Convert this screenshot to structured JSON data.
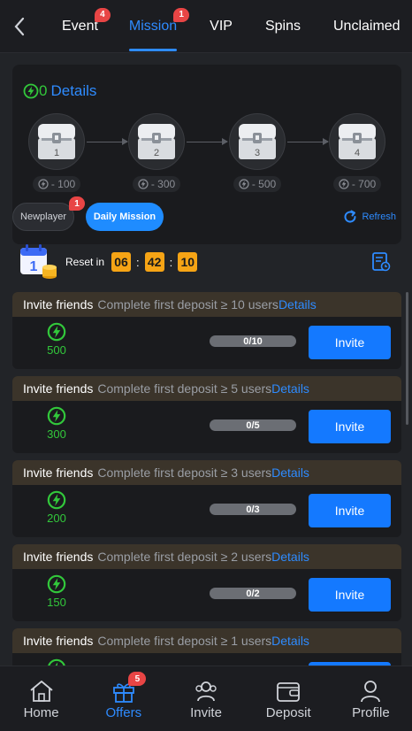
{
  "top_nav": {
    "tabs": [
      {
        "label": "Event",
        "badge": "4"
      },
      {
        "label": "Mission",
        "badge": "1",
        "active": true
      },
      {
        "label": "VIP"
      },
      {
        "label": "Spins"
      },
      {
        "label": "Unclaimed"
      }
    ]
  },
  "panel": {
    "count": "0",
    "details": "Details",
    "chests": [
      {
        "num": "1",
        "cost": "- 100"
      },
      {
        "num": "2",
        "cost": "- 300"
      },
      {
        "num": "3",
        "cost": "- 500"
      },
      {
        "num": "4",
        "cost": "- 700"
      }
    ]
  },
  "sub_tabs": {
    "newplayer": "Newplayer",
    "newplayer_badge": "1",
    "daily": "Daily Mission",
    "refresh": "Refresh"
  },
  "reset": {
    "label": "Reset in",
    "hours": "06",
    "minutes": "42",
    "seconds": "10"
  },
  "tasks": [
    {
      "title": "Invite friends",
      "desc": "Complete first deposit ≥ 10 users",
      "link": "Details",
      "reward": "500",
      "progress": "0/10",
      "button": "Invite"
    },
    {
      "title": "Invite friends",
      "desc": "Complete first deposit ≥ 5 users",
      "link": "Details",
      "reward": "300",
      "progress": "0/5",
      "button": "Invite"
    },
    {
      "title": "Invite friends",
      "desc": "Complete first deposit ≥ 3 users",
      "link": "Details",
      "reward": "200",
      "progress": "0/3",
      "button": "Invite"
    },
    {
      "title": "Invite friends",
      "desc": "Complete first deposit ≥ 2 users",
      "link": "Details",
      "reward": "150",
      "progress": "0/2",
      "button": "Invite"
    },
    {
      "title": "Invite friends",
      "desc": "Complete first deposit ≥ 1 users",
      "link": "Details",
      "reward": "",
      "progress": "",
      "button": ""
    }
  ],
  "bottom_nav": {
    "items": [
      {
        "label": "Home",
        "icon": "home-icon"
      },
      {
        "label": "Offers",
        "icon": "gift-icon",
        "badge": "5",
        "active": true
      },
      {
        "label": "Invite",
        "icon": "users-icon"
      },
      {
        "label": "Deposit",
        "icon": "wallet-icon"
      },
      {
        "label": "Profile",
        "icon": "user-icon"
      }
    ]
  },
  "colors": {
    "accent": "#2e8bff",
    "green": "#32c83b",
    "badge": "#e84545",
    "timer": "#f6a415",
    "button": "#1479ff"
  }
}
